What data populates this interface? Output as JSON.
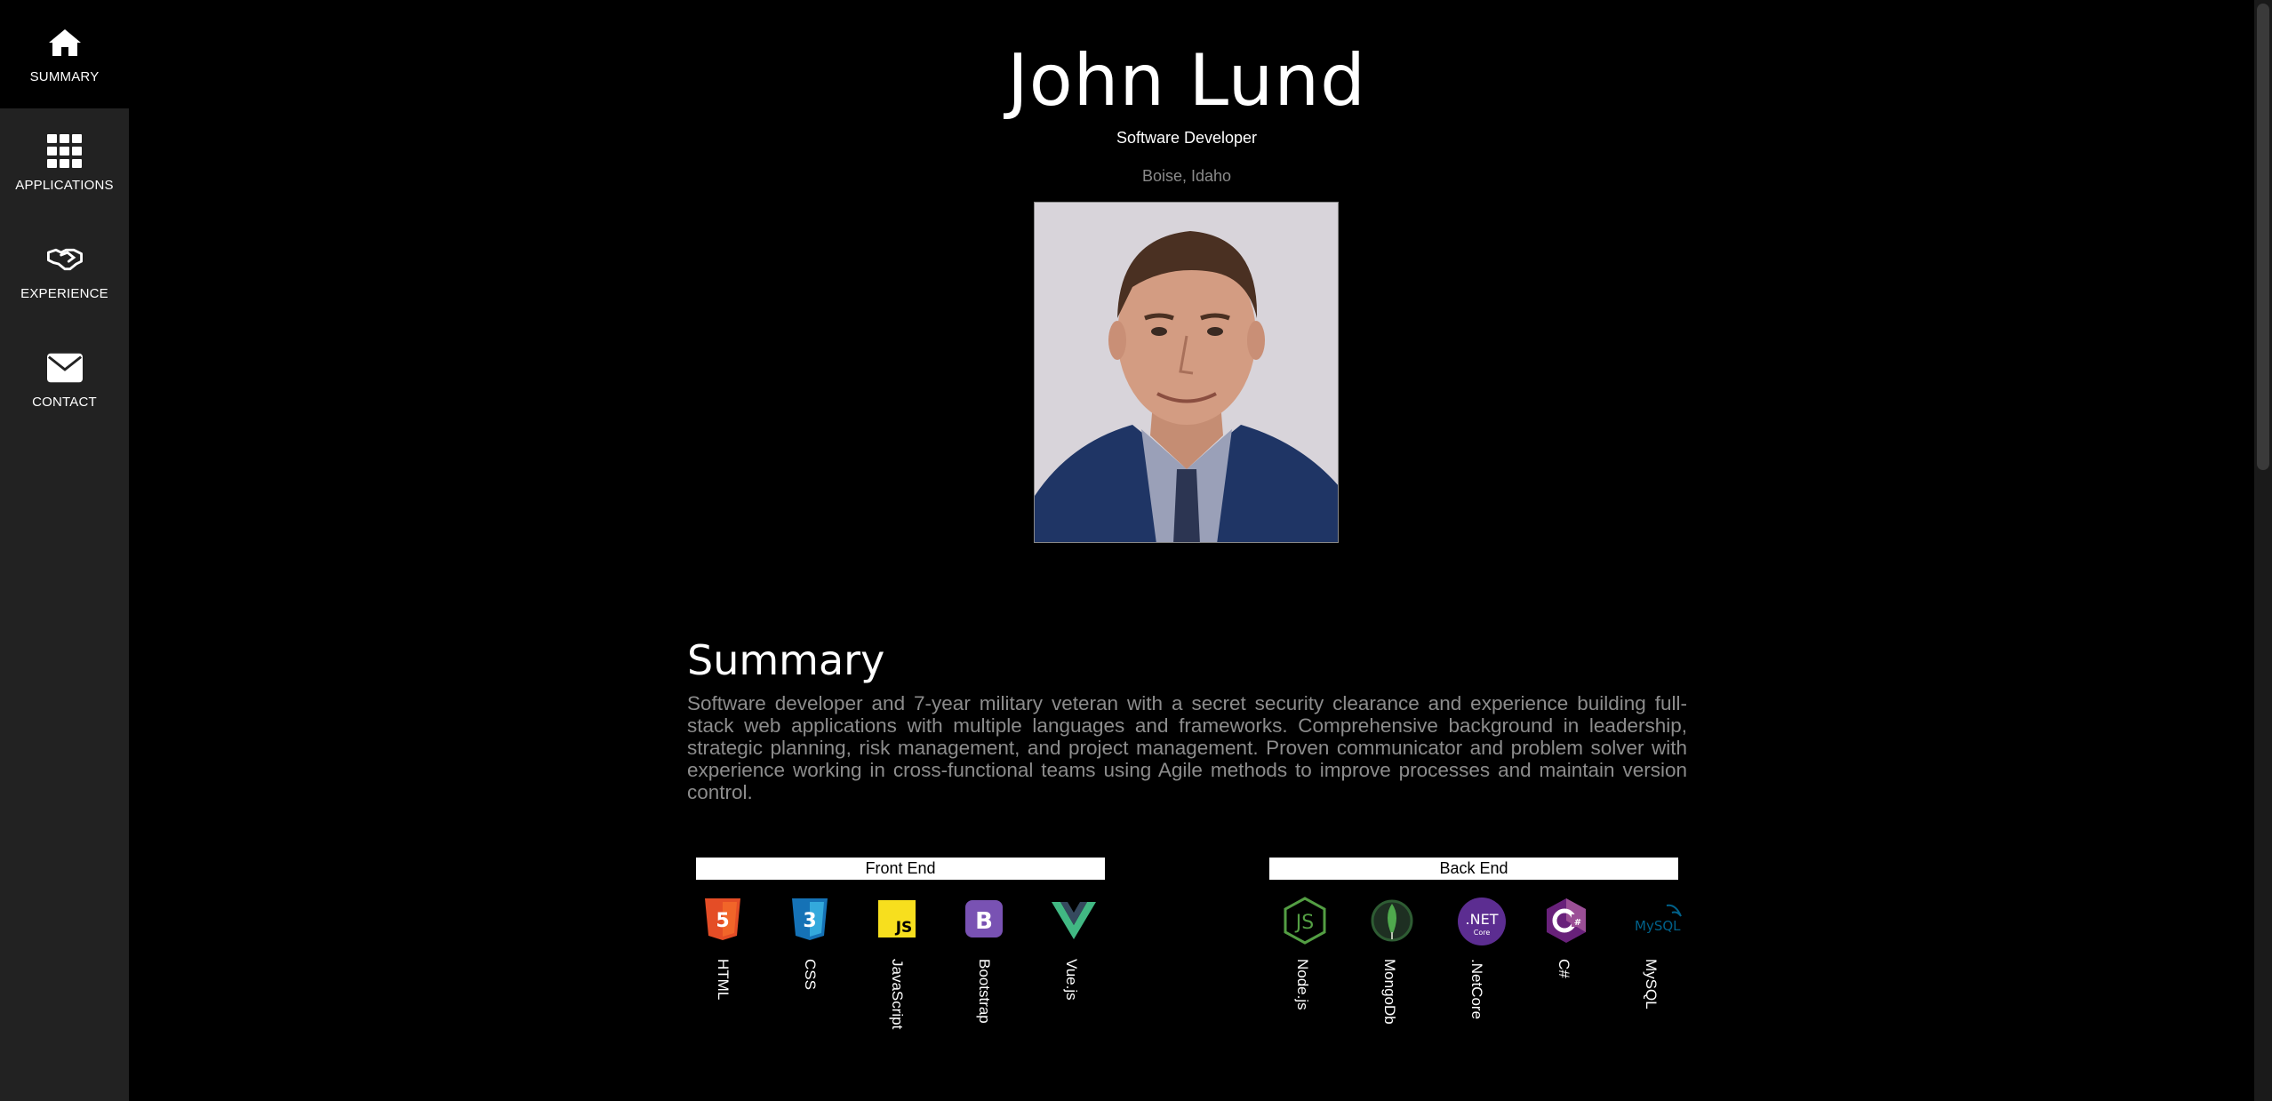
{
  "sidebar": {
    "items": [
      {
        "label": "SUMMARY",
        "icon": "home-icon"
      },
      {
        "label": "APPLICATIONS",
        "icon": "grid-icon"
      },
      {
        "label": "EXPERIENCE",
        "icon": "handshake-icon"
      },
      {
        "label": "CONTACT",
        "icon": "envelope-icon"
      }
    ]
  },
  "header": {
    "name": "John Lund",
    "title": "Software Developer",
    "location": "Boise, Idaho"
  },
  "summary": {
    "heading": "Summary",
    "text": "Software developer and 7-year military veteran with a secret security clearance and experience building full-stack web applications with multiple languages and frameworks. Comprehensive background in leadership, strategic planning, risk management, and project management. Proven communicator and problem solver with experience working in cross-functional teams using Agile methods to improve processes and maintain version control."
  },
  "skills": {
    "front_end": {
      "heading": "Front End",
      "items": [
        "HTML",
        "CSS",
        "JavaScript",
        "Bootstrap",
        "Vue.js"
      ]
    },
    "back_end": {
      "heading": "Back End",
      "items": [
        "Node.js",
        "MongoDb",
        ".NetCore",
        "C#",
        "MySQL"
      ],
      "net_badge": ".NET",
      "net_sub": "Core",
      "mysql_badge": "MySQL",
      "js_badge": "JS"
    }
  },
  "colors": {
    "sidebar_bg": "#222222",
    "page_bg": "#000000",
    "muted_text": "#8c8c8c"
  }
}
